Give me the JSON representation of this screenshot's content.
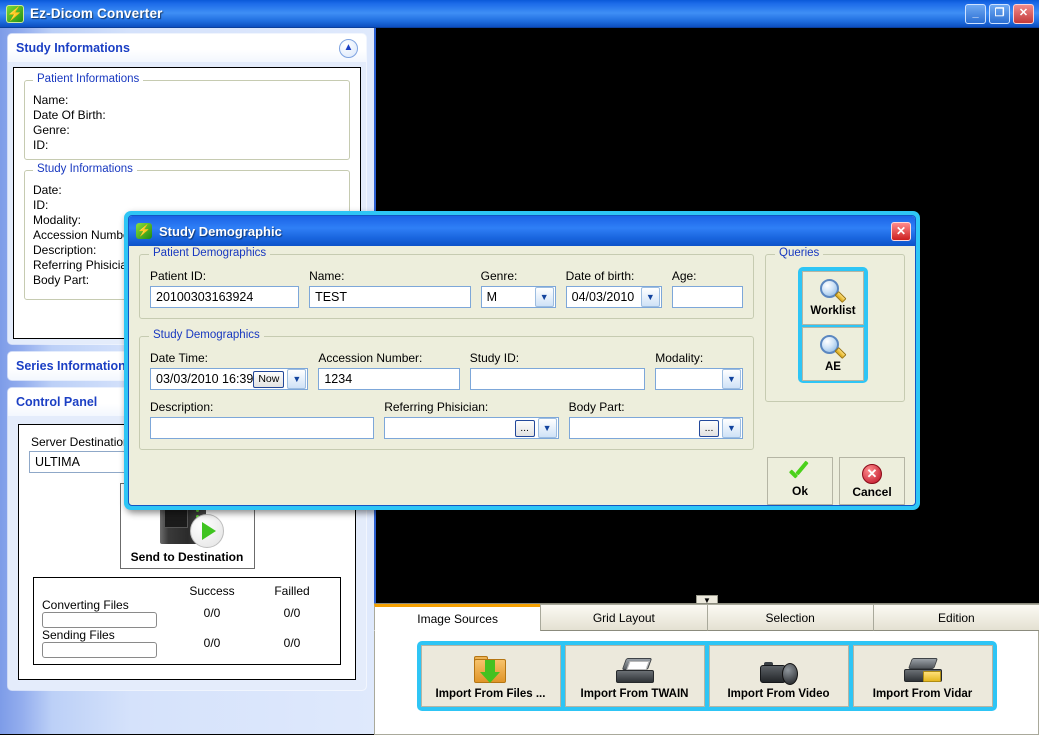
{
  "window": {
    "title": "Ez-Dicom Converter",
    "icon": "lightning-icon",
    "buttons": {
      "minimize": "_",
      "maximize": "❐",
      "close": "✕"
    }
  },
  "sidebar": {
    "panels": [
      {
        "title": "Study Informations",
        "collapse_icon": "chevron-up-icon",
        "groups": [
          {
            "legend": "Patient Informations",
            "fields": [
              "Name:",
              "Date Of Birth:",
              "Genre:",
              "ID:"
            ]
          },
          {
            "legend": "Study Informations",
            "fields": [
              "Date:",
              "ID:",
              "Modality:",
              "Accession Number:",
              "Description:",
              "Referring Phisician:",
              "Body Part:"
            ]
          }
        ]
      },
      {
        "title": "Series Informations"
      },
      {
        "title": "Control Panel"
      }
    ],
    "control_panel": {
      "server_label": "Server Destination:",
      "server_value": "ULTIMA",
      "send_button": "Send to Destination",
      "stats": {
        "col_success": "Success",
        "col_failed": "Failled",
        "rows": [
          {
            "label": "Converting Files",
            "success": "0/0",
            "failed": "0/0"
          },
          {
            "label": "Sending Files",
            "success": "0/0",
            "failed": "0/0"
          }
        ]
      }
    }
  },
  "viewer": {
    "splitter_icon": "chevron-down-icon"
  },
  "tabs": {
    "items": [
      {
        "label": "Image Sources",
        "active": true
      },
      {
        "label": "Grid Layout",
        "active": false
      },
      {
        "label": "Selection",
        "active": false
      },
      {
        "label": "Edition",
        "active": false
      }
    ],
    "image_sources": [
      {
        "label": "Import From Files ...",
        "icon": "folder-download-icon"
      },
      {
        "label": "Import From TWAIN",
        "icon": "scanner-icon"
      },
      {
        "label": "Import From Video",
        "icon": "video-camera-icon"
      },
      {
        "label": "Import From Vidar",
        "icon": "vidar-scanner-icon"
      }
    ]
  },
  "dialog": {
    "title": "Study Demographic",
    "icon": "lightning-icon",
    "close": "✕",
    "patient_group": {
      "legend": "Patient Demographics",
      "patient_id": {
        "label": "Patient ID:",
        "value": "20100303163924"
      },
      "name": {
        "label": "Name:",
        "value": "TEST"
      },
      "genre": {
        "label": "Genre:",
        "value": "M"
      },
      "dob": {
        "label": "Date of birth:",
        "value": "04/03/2010"
      },
      "age": {
        "label": "Age:",
        "value": ""
      }
    },
    "study_group": {
      "legend": "Study Demographics",
      "date_time": {
        "label": "Date Time:",
        "value": "03/03/2010 16:39",
        "now_button": "Now"
      },
      "accession": {
        "label": "Accession Number:",
        "value": "1234"
      },
      "study_id": {
        "label": "Study ID:",
        "value": ""
      },
      "modality": {
        "label": "Modality:",
        "value": ""
      },
      "description": {
        "label": "Description:",
        "value": ""
      },
      "referring": {
        "label": "Referring Phisician:",
        "value": "",
        "browse_button": "..."
      },
      "body_part": {
        "label": "Body Part:",
        "value": "",
        "browse_button": "..."
      }
    },
    "queries": {
      "legend": "Queries",
      "buttons": [
        {
          "label": "Worklist",
          "icon": "magnifier-icon"
        },
        {
          "label": "AE",
          "icon": "magnifier-icon"
        }
      ]
    },
    "actions": [
      {
        "label": "Ok",
        "icon": "check-icon"
      },
      {
        "label": "Cancel",
        "icon": "cancel-circle-icon"
      }
    ]
  },
  "colors": {
    "titlebar_blue": "#1a66df",
    "accent_cyan": "#2ec5f5",
    "dialog_bg": "#edeedc",
    "active_tab_top": "#f5a000",
    "legend_blue": "#1838c0"
  }
}
